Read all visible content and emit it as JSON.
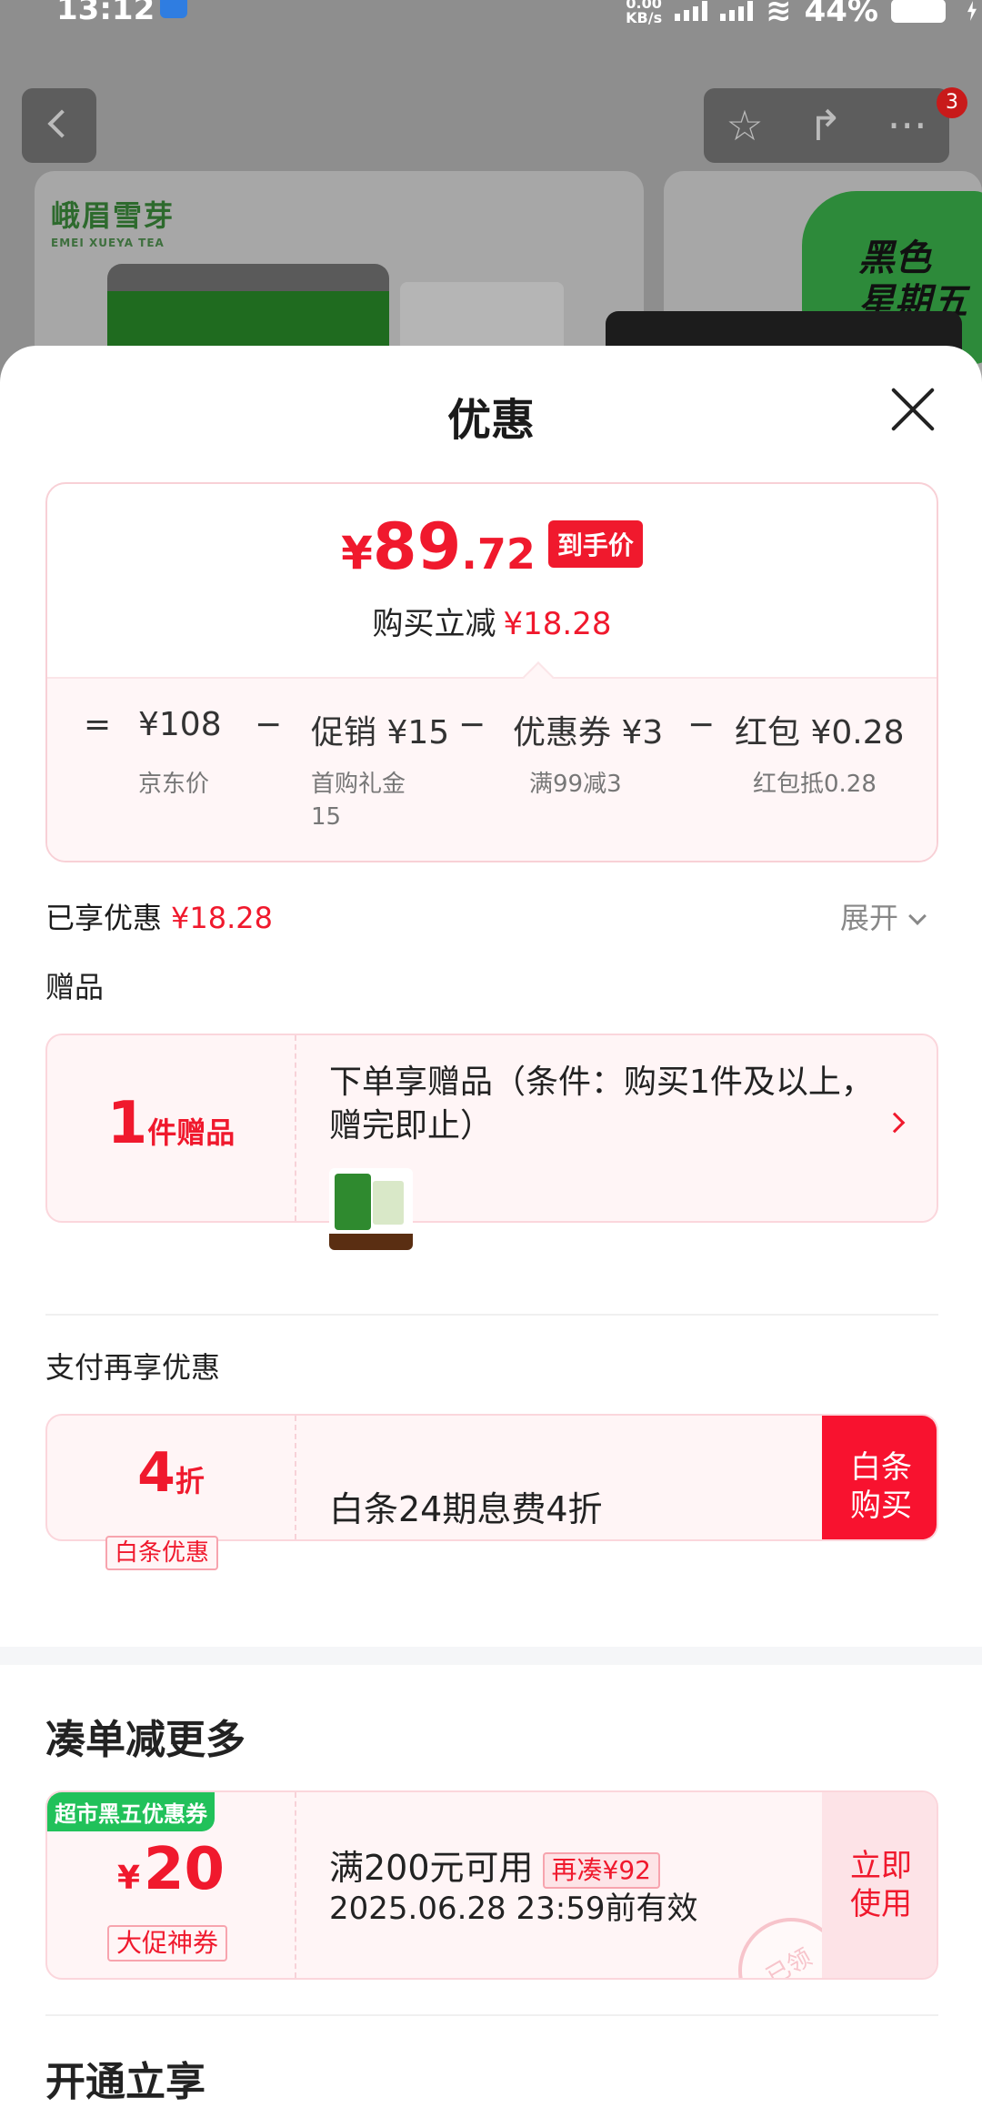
{
  "status_bar": {
    "time": "13:12",
    "net_speed_value": "0.00",
    "net_speed_unit": "KB/s",
    "battery": "44%"
  },
  "background": {
    "brand_name": "峨眉雪芽",
    "brand_sub": "EMEI XUEYA TEA",
    "promo_text_1": "黑色",
    "promo_text_2": "星期五",
    "cart_badge": "3",
    "star_icon": "☆",
    "share_icon": "↱",
    "more_icon": "···"
  },
  "sheet": {
    "title": "优惠"
  },
  "price_card": {
    "yen": "¥",
    "price_int": "89",
    "price_dec": ".72",
    "price_tag": "到手价",
    "saved_label": "购买立减",
    "saved_value": "¥18.28",
    "calc": {
      "eq": "=",
      "base_value": "¥108",
      "minus": "−",
      "promo": "促销 ¥15",
      "coupon": "优惠券 ¥3",
      "redpack": "红包 ¥0.28",
      "base_label": "京东价",
      "promo_desc": "首购礼金\n15",
      "coupon_desc": "满99减3",
      "redpack_desc": "红包抵0.28"
    }
  },
  "enjoyed": {
    "label": "已享优惠",
    "value": "¥18.28",
    "expand_label": "展开"
  },
  "gift": {
    "section_label": "赠品",
    "count": "1",
    "unit": "件赠品",
    "description": "下单享赠品（条件：购买1件及以上，赠完即止）"
  },
  "payment": {
    "section_label": "支付再享优惠",
    "discount_value": "4",
    "discount_unit": "折",
    "pill": "白条优惠",
    "description": "白条24期息费4折",
    "button_label": "白条\n购买"
  },
  "more": {
    "title": "凑单减更多",
    "coupon": {
      "tag": "超市黑五优惠券",
      "yen": "¥",
      "amount": "20",
      "pill": "大促神券",
      "condition": "满200元可用",
      "need_more": "再凑¥92",
      "validity": "2025.06.28 23:59前有效",
      "button_label": "立即\n使用",
      "stamp": "已领"
    }
  },
  "vip": {
    "title": "开通立享"
  }
}
